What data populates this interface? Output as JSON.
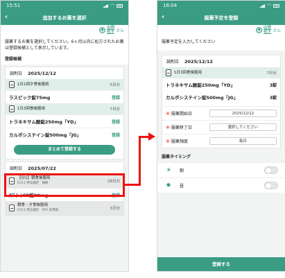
{
  "left": {
    "time": "15:51",
    "title": "追加するお薬を選択",
    "user": {
      "name_line1": "山田",
      "name_line2": "花子",
      "suffix": "さん"
    },
    "description": "服薬するお薬を選択してください。6ヶ月以内に処方されたお薬は登録候補として表示しています。",
    "candidates_label": "登録候補",
    "card1": {
      "date_label": "調剤日",
      "date": "2025/12/12",
      "groups": [
        {
          "timing": "1日1回夕食後服用",
          "days": "5日分",
          "drug": "ラスピック錠75mg",
          "action": "登録"
        },
        {
          "timing": "1日3回食後服用",
          "days": "7日分",
          "drug": "トラネキサム酸錠250mg「YD」",
          "drug2": "カルボシステイン錠500mg「JG」",
          "action": "登録"
        }
      ],
      "bulk_button": "まとめて登録する"
    },
    "card2": {
      "date_label": "調剤日",
      "date": "2025/07/22",
      "groups": [
        {
          "timing": "【分1】朝食後服用",
          "sub": "R311 用法補足　朝餅",
          "days": "28日分",
          "drug": "ｱﾃﾞﾗｰﾄCR錠20mg",
          "action": "登録"
        },
        {
          "timing": "朝食・夕食後服用",
          "sub": "R311 用法補足　RP1 前用後",
          "days": "3日分"
        }
      ]
    }
  },
  "right": {
    "time": "16:04",
    "title": "服薬予定を登録",
    "user": {
      "name_line1": "山田",
      "name_line2": "花子",
      "suffix": "さん"
    },
    "description": "服薬予定を入力してください",
    "card": {
      "date_label": "調剤日",
      "date": "2025/12/12",
      "timing": "1日3回食後服用",
      "days": "7日分",
      "drugs": [
        {
          "name": "トラネキサム酸錠250mg「YD」",
          "qty": "3錠"
        },
        {
          "name": "カルボシステイン錠500mg「JG」",
          "qty": "3錠"
        }
      ],
      "form": {
        "start_label": "服薬開始日",
        "start_value": "2025/12/12",
        "end_label": "服薬終了日",
        "end_value": "選択してください",
        "freq_label": "服薬頻度",
        "freq_value": "毎日"
      }
    },
    "timing_section": "服薬タイミング",
    "timings": [
      {
        "label": "朝"
      },
      {
        "label": "昼"
      }
    ],
    "register_button": "登録する"
  }
}
